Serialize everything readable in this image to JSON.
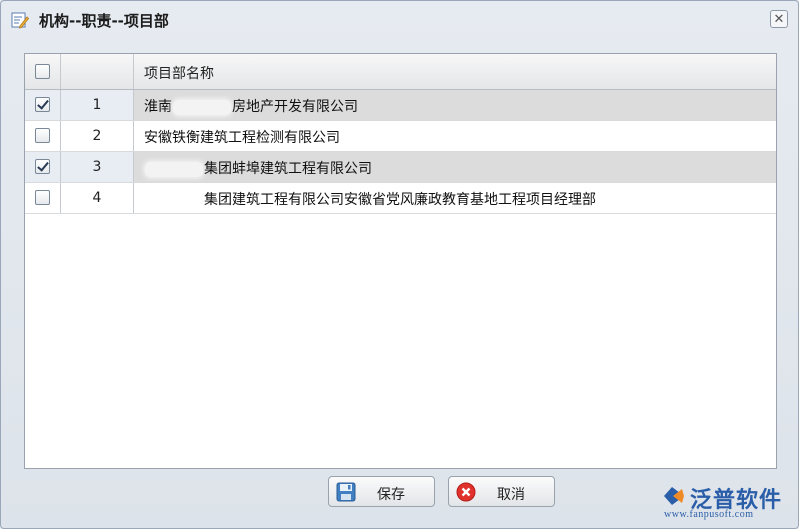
{
  "dialog": {
    "title": "机构--职责--项目部",
    "close_label": "✕"
  },
  "grid": {
    "columns": [
      "",
      "",
      "项目部名称"
    ],
    "header_checked": false,
    "rows": [
      {
        "num": "1",
        "checked": true,
        "name_prefix": "淮南",
        "name_suffix": "房地产开发有限公司",
        "redacted": true,
        "redact_width": 58,
        "selected": true
      },
      {
        "num": "2",
        "checked": false,
        "name_prefix": "安徽铁衡建筑工程检测有限公司",
        "name_suffix": "",
        "redacted": false,
        "redact_width": 0,
        "selected": false
      },
      {
        "num": "3",
        "checked": true,
        "name_prefix": "",
        "name_suffix": "集团蚌埠建筑工程有限公司",
        "redacted": true,
        "redact_width": 58,
        "selected": true
      },
      {
        "num": "4",
        "checked": false,
        "name_prefix": "",
        "name_suffix": "集团建筑工程有限公司安徽省党风廉政教育基地工程项目经理部",
        "redacted": true,
        "redact_width": 58,
        "selected": false
      }
    ]
  },
  "buttons": {
    "save_label": "保存",
    "cancel_label": "取消"
  },
  "brand": {
    "name": "泛普软件",
    "url": "www.fanpusoft.com",
    "color": "#2b5ea8"
  },
  "icons": {
    "title": "form-edit-icon",
    "save": "floppy-disk-icon",
    "cancel": "cancel-circle-icon"
  }
}
